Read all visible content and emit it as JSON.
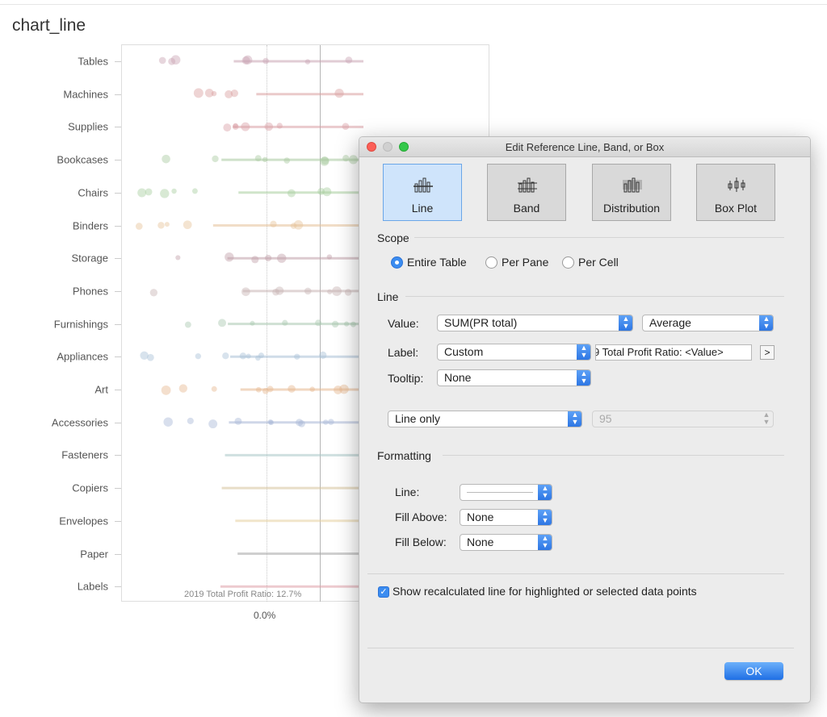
{
  "sheet": {
    "title": "chart_line"
  },
  "chart_data": {
    "type": "scatter",
    "categories": [
      "Tables",
      "Machines",
      "Supplies",
      "Bookcases",
      "Chairs",
      "Binders",
      "Storage",
      "Phones",
      "Furnishings",
      "Appliances",
      "Art",
      "Accessories",
      "Fasteners",
      "Copiers",
      "Envelopes",
      "Paper",
      "Labels"
    ],
    "x_tick_labels": [
      "0.0%"
    ],
    "reference_line_label": "2019 Total Profit Ratio: 12.7%",
    "reference_value": 12.7,
    "grid": false
  },
  "dialog": {
    "title": "Edit Reference Line, Band, or Box",
    "types": [
      {
        "label": "Line"
      },
      {
        "label": "Band"
      },
      {
        "label": "Distribution"
      },
      {
        "label": "Box Plot"
      }
    ],
    "scope": {
      "heading": "Scope",
      "options": [
        "Entire Table",
        "Per Pane",
        "Per Cell"
      ],
      "selected": "Entire Table"
    },
    "line": {
      "heading": "Line",
      "value_label": "Value:",
      "value": "SUM(PR total)",
      "aggregation": "Average",
      "label_label": "Label:",
      "label_mode": "Custom",
      "label_text": "9 Total Profit Ratio: <Value>",
      "label_button": ">",
      "tooltip_label": "Tooltip:",
      "tooltip": "None",
      "interval": "Line only",
      "interval_value": "95"
    },
    "formatting": {
      "heading": "Formatting",
      "line_label": "Line:",
      "fill_above_label": "Fill Above:",
      "fill_above": "None",
      "fill_below_label": "Fill Below:",
      "fill_below": "None"
    },
    "recalculated_label": "Show recalculated line for highlighted or selected data points",
    "recalculated_checked": true,
    "ok_label": "OK"
  },
  "colors": {
    "accent": "#3b8cf0",
    "selected_type_bg": "#cfe4fb"
  }
}
